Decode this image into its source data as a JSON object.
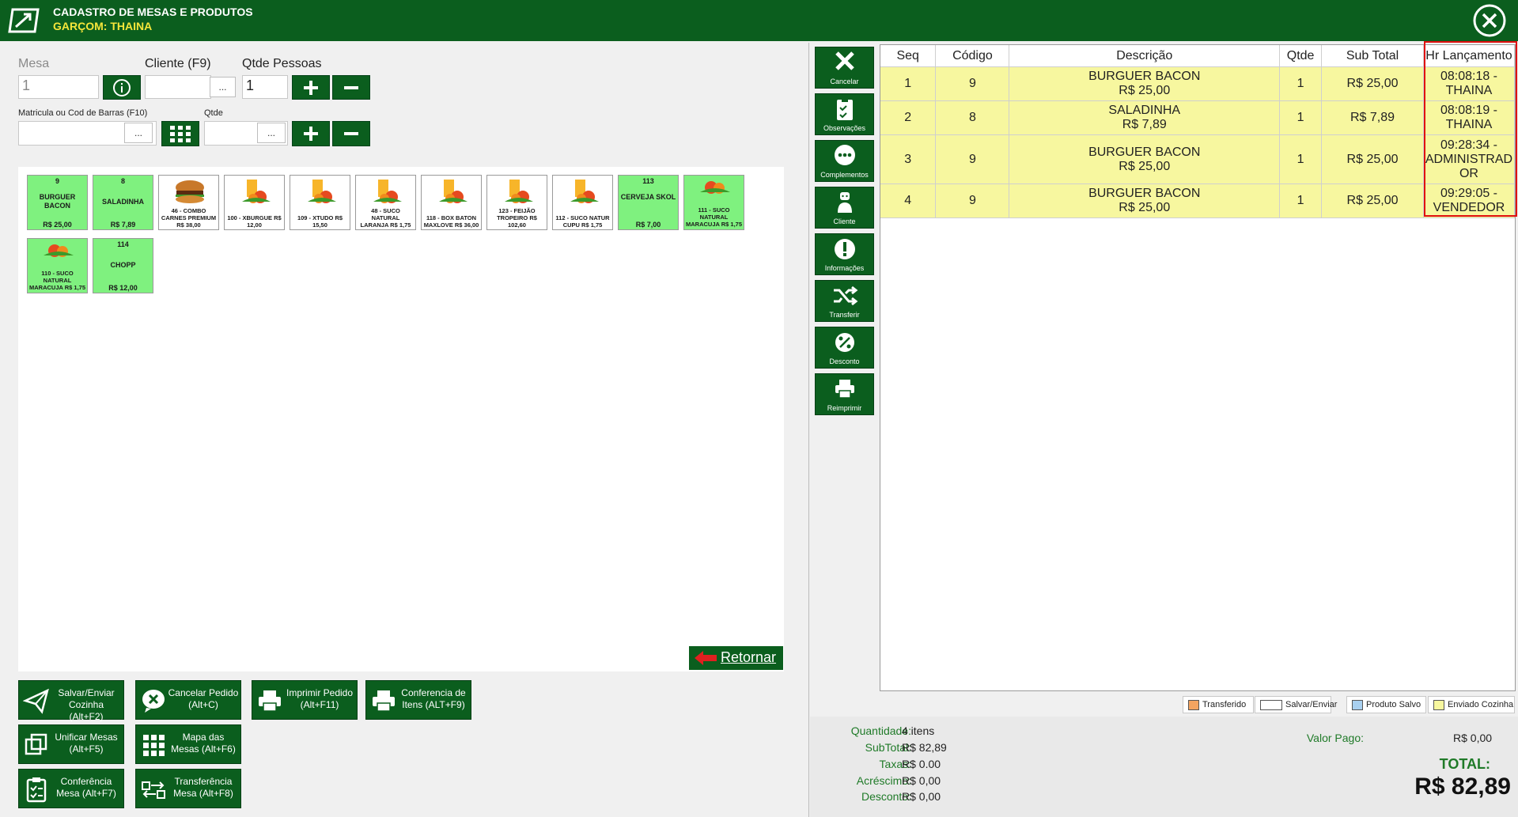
{
  "header": {
    "title": "CADASTRO DE MESAS E PRODUTOS",
    "waiter": "GARÇOM: THAINA"
  },
  "form": {
    "mesa_label": "Mesa",
    "mesa_value": "1",
    "cliente_label": "Cliente (F9)",
    "cliente_value": "",
    "qtde_pessoas_label": "Qtde Pessoas",
    "qtde_pessoas_value": "1",
    "matricula_label": "Matricula ou Cod de Barras (F10)",
    "matricula_value": "",
    "qtde_label": "Qtde",
    "qtde_value": "",
    "dots": "..."
  },
  "products": [
    {
      "code": "9",
      "name": "BURGUER BACON",
      "price": "R$ 25,00",
      "has_image": false
    },
    {
      "code": "8",
      "name": "SALADINHA",
      "price": "R$ 7,89",
      "has_image": false
    },
    {
      "caption": "46 - COMBO CARNES PREMIUM R$ 38,00",
      "has_image": true,
      "image": "burger"
    },
    {
      "caption": "100 - XBURGUE R$ 12,00",
      "has_image": true,
      "image": "juice-fruit"
    },
    {
      "caption": "109 - XTUDO R$ 15,50",
      "has_image": true,
      "image": "juice-fruit"
    },
    {
      "caption": "48 - SUCO NATURAL LARANJA R$ 1,75",
      "has_image": true,
      "image": "juice-fruit"
    },
    {
      "caption": "118 - BOX BATON MAXLOVE R$ 36,00",
      "has_image": true,
      "image": "juice-fruit"
    },
    {
      "caption": "123 - FEIJÃO TROPEIRO R$ 102,60",
      "has_image": true,
      "image": "juice-fruit"
    },
    {
      "caption": "112 - SUCO NATUR CUPU R$ 1,75",
      "has_image": true,
      "image": "juice-fruit"
    },
    {
      "code": "113",
      "name": "CERVEJA SKOL",
      "price": "R$ 7,00",
      "has_image": false
    },
    {
      "caption": "111 - SUCO NATURAL MARACUJA R$ 1,75",
      "has_image": true,
      "image": "fruit"
    },
    {
      "caption": "110 - SUCO NATURAL MARACUJA R$ 1,75",
      "has_image": true,
      "image": "fruit"
    },
    {
      "code": "114",
      "name": "CHOPP",
      "price": "R$ 12,00",
      "has_image": false
    }
  ],
  "return_button": "Retornar",
  "actions": [
    {
      "label": "Salvar/Enviar Cozinha (Alt+F2)",
      "icon": "send-icon"
    },
    {
      "label": "Cancelar Pedido (Alt+C)",
      "icon": "cancel-chat-icon"
    },
    {
      "label": "Imprimir Pedido (Alt+F11)",
      "icon": "printer-icon"
    },
    {
      "label": "Conferencia de Itens (ALT+F9)",
      "icon": "printer-icon"
    },
    {
      "label": "Unificar Mesas (Alt+F5)",
      "icon": "merge-icon"
    },
    {
      "label": "Mapa das Mesas (Alt+F6)",
      "icon": "grid-icon"
    },
    {
      "label": "Conferência Mesa (Alt+F7)",
      "icon": "clipboard-icon"
    },
    {
      "label": "Transferência Mesa (Alt+F8)",
      "icon": "transfer-icon"
    }
  ],
  "side_actions": [
    {
      "label": "Cancelar",
      "icon": "x-icon"
    },
    {
      "label": "Observações",
      "icon": "clipboard-check-icon"
    },
    {
      "label": "Complementos",
      "icon": "chat-dots-icon"
    },
    {
      "label": "Cliente",
      "icon": "person-icon"
    },
    {
      "label": "Informações",
      "icon": "alert-icon"
    },
    {
      "label": "Transferir",
      "icon": "shuffle-icon"
    },
    {
      "label": "Desconto",
      "icon": "percent-icon"
    },
    {
      "label": "Reimprimir",
      "icon": "printer-icon"
    }
  ],
  "table": {
    "columns": [
      "Seq",
      "Código",
      "Descrição",
      "Qtde",
      "Sub Total",
      "Hr Lançamento"
    ],
    "rows": [
      {
        "seq": "1",
        "code": "9",
        "desc1": "BURGUER BACON",
        "desc2": "R$ 25,00",
        "qtde": "1",
        "subtotal": "R$ 25,00",
        "hr1": "08:08:18 -",
        "hr2": "THAINA",
        "hr3": ""
      },
      {
        "seq": "2",
        "code": "8",
        "desc1": "SALADINHA",
        "desc2": "R$ 7,89",
        "qtde": "1",
        "subtotal": "R$ 7,89",
        "hr1": "08:08:19 -",
        "hr2": "THAINA",
        "hr3": ""
      },
      {
        "seq": "3",
        "code": "9",
        "desc1": "BURGUER BACON",
        "desc2": "R$ 25,00",
        "qtde": "1",
        "subtotal": "R$ 25,00",
        "hr1": "09:28:34 -",
        "hr2": "ADMINISTRAD",
        "hr3": "OR"
      },
      {
        "seq": "4",
        "code": "9",
        "desc1": "BURGUER BACON",
        "desc2": "R$ 25,00",
        "qtde": "1",
        "subtotal": "R$ 25,00",
        "hr1": "09:29:05 -",
        "hr2": "VENDEDOR",
        "hr3": ""
      }
    ]
  },
  "legend": [
    {
      "label": "Transferido",
      "color": "#f4a460"
    },
    {
      "label": "Salvar/Enviar",
      "color": "#ffffff"
    },
    {
      "label": "Produto Salvo",
      "color": "#a8d0f0"
    },
    {
      "label": "Enviado Cozinha",
      "color": "#f7f79f"
    }
  ],
  "totals": {
    "quantidade_label": "Quantidade:",
    "quantidade": "4 itens",
    "subtotal_label": "SubTotal:",
    "subtotal": "R$ 82,89",
    "taxas_label": "Taxas:",
    "taxas": "R$ 0.00",
    "acrescimo_label": "Acréscimo:",
    "acrescimo": "R$ 0,00",
    "desconto_label": "Desconto:",
    "desconto": "R$ 0,00",
    "valor_pago_label": "Valor Pago:",
    "valor_pago": "R$ 0,00",
    "total_label": "TOTAL:",
    "total": "R$ 82,89"
  },
  "colors": {
    "brand": "#0b5e1e",
    "accent_yellow": "#f5e63a",
    "tile_green": "#7ff17f",
    "row_yellow": "#f7f79f",
    "highlight": "#e01010"
  }
}
